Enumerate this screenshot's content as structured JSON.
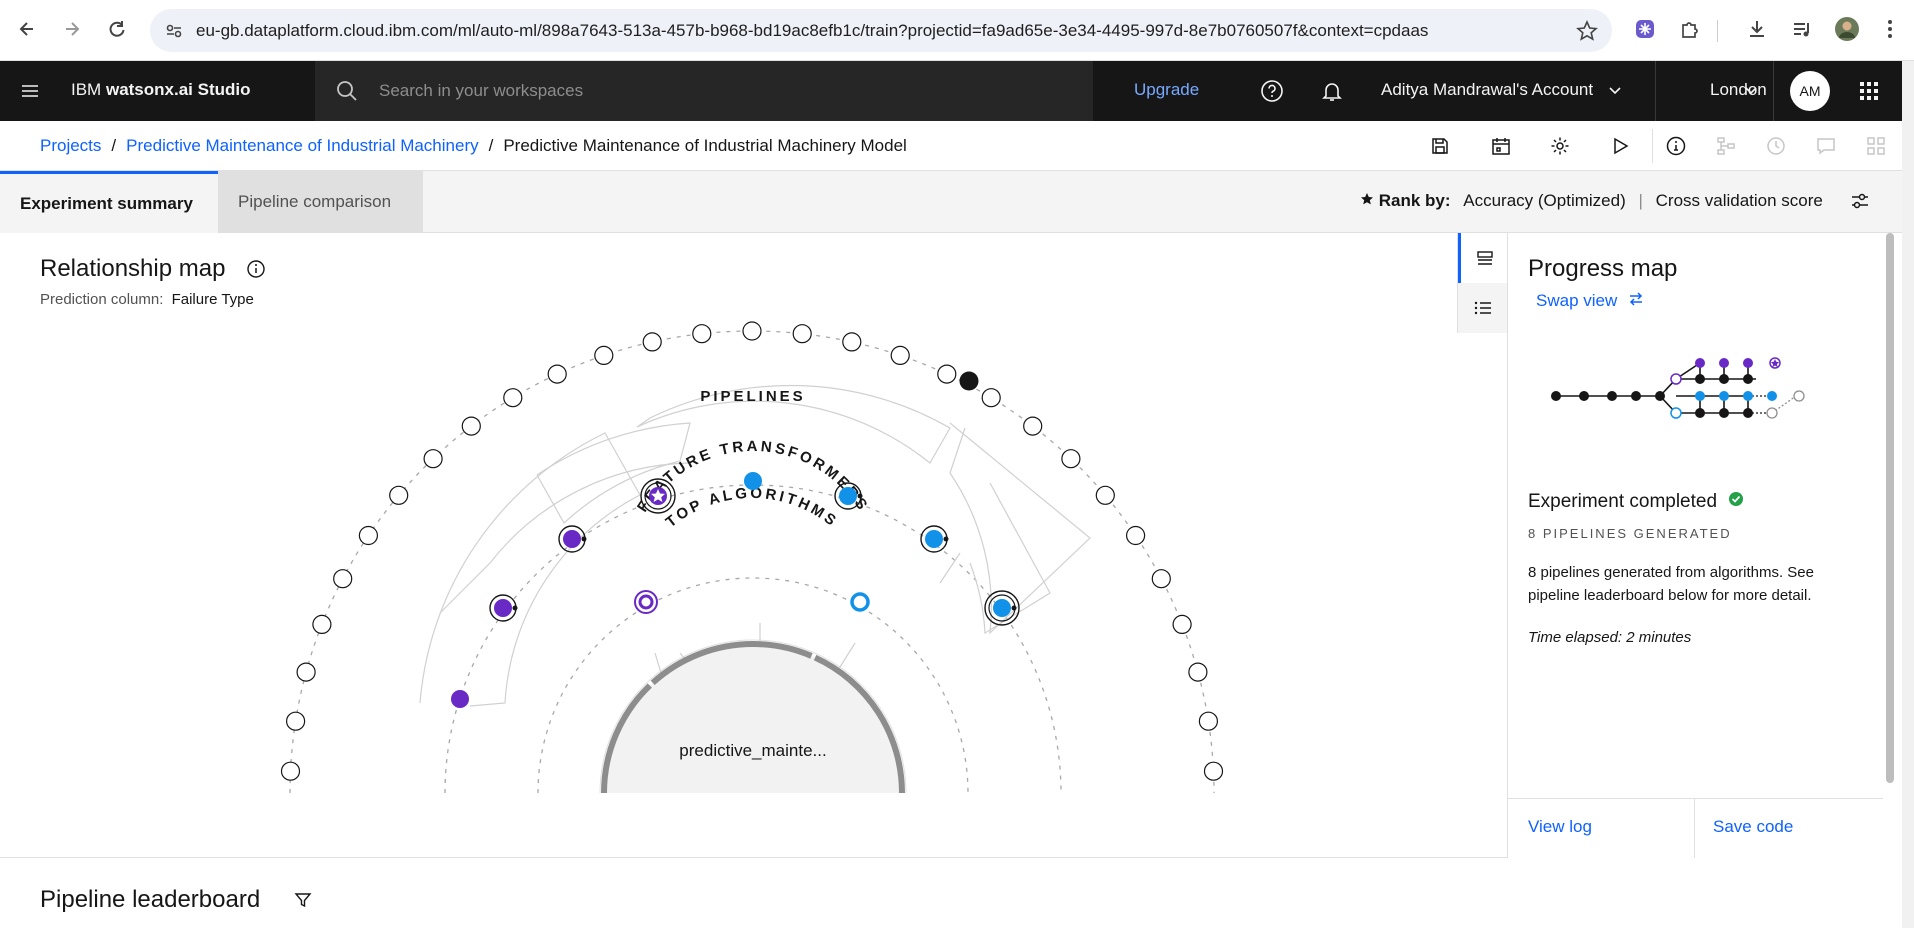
{
  "browser": {
    "url": "eu-gb.dataplatform.cloud.ibm.com/ml/auto-ml/898a7643-513a-457b-b968-bd19ac8efb1c/train?projectid=fa9ad65e-3e34-4495-997d-8e7b0760507f&context=cpdaas"
  },
  "header": {
    "brand_prefix": "IBM",
    "brand_product": "watsonx.ai Studio",
    "search_placeholder": "Search in your workspaces",
    "upgrade_label": "Upgrade",
    "account_label": "Aditya Mandrawal's Account",
    "region_label": "London",
    "avatar_initials": "AM"
  },
  "breadcrumb": {
    "items": [
      "Projects",
      "Predictive Maintenance of Industrial Machinery"
    ],
    "current": "Predictive Maintenance of Industrial Machinery Model"
  },
  "tabs": {
    "summary": "Experiment summary",
    "comparison": "Pipeline comparison"
  },
  "rank": {
    "label": "Rank by:",
    "metric": "Accuracy (Optimized)",
    "score_type": "Cross validation score"
  },
  "relationship_map": {
    "title": "Relationship map",
    "prediction_label": "Prediction column:",
    "prediction_value": "Failure Type",
    "ring_outer": "FEATURE TRANSFORMERS",
    "ring_middle": "PIPELINES",
    "ring_inner": "TOP ALGORITHMS",
    "center_label": "predictive_mainte..."
  },
  "progress_map": {
    "title": "Progress map",
    "swap_label": "Swap view",
    "status_title": "Experiment completed",
    "pipelines_generated": "8 PIPELINES GENERATED",
    "description": "8 pipelines generated from algorithms. See pipeline leaderboard below for more detail.",
    "time_elapsed": "Time elapsed: 2 minutes",
    "view_log": "View log",
    "save_code": "Save code"
  },
  "leaderboard": {
    "title": "Pipeline leaderboard"
  },
  "colors": {
    "accent_blue": "#0f62fe",
    "pipeline_purple": "#6929c4",
    "pipeline_blue": "#1192e8",
    "success_green": "#24a148",
    "header_bg": "#161616"
  }
}
